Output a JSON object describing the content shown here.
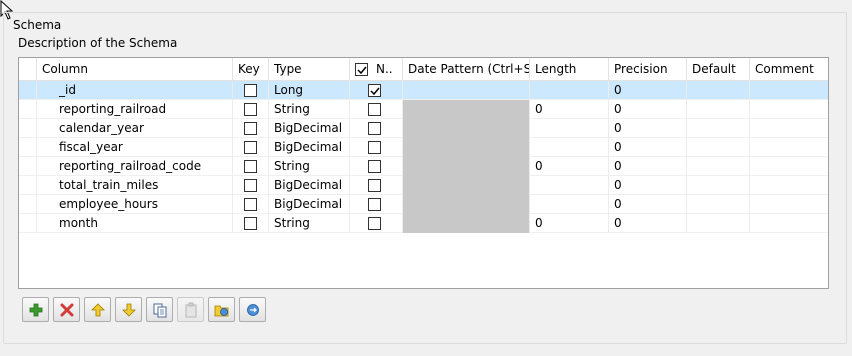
{
  "group": {
    "title": "Schema"
  },
  "description_label": "Description of the Schema",
  "columns": {
    "column": "Column",
    "key": "Key",
    "type": "Type",
    "nullable": "N..",
    "date_pattern": "Date Pattern (Ctrl+S...",
    "length": "Length",
    "precision": "Precision",
    "default": "Default",
    "comment": "Comment"
  },
  "rows": [
    {
      "column": "_id",
      "key": false,
      "type": "Long",
      "nullable": true,
      "length": "",
      "precision": "0",
      "default": "",
      "comment": ""
    },
    {
      "column": "reporting_railroad",
      "key": false,
      "type": "String",
      "nullable": false,
      "length": "0",
      "precision": "0",
      "default": "",
      "comment": ""
    },
    {
      "column": "calendar_year",
      "key": false,
      "type": "BigDecimal",
      "nullable": false,
      "length": "",
      "precision": "0",
      "default": "",
      "comment": ""
    },
    {
      "column": "fiscal_year",
      "key": false,
      "type": "BigDecimal",
      "nullable": false,
      "length": "",
      "precision": "0",
      "default": "",
      "comment": ""
    },
    {
      "column": "reporting_railroad_code",
      "key": false,
      "type": "String",
      "nullable": false,
      "length": "0",
      "precision": "0",
      "default": "",
      "comment": ""
    },
    {
      "column": "total_train_miles",
      "key": false,
      "type": "BigDecimal",
      "nullable": false,
      "length": "",
      "precision": "0",
      "default": "",
      "comment": ""
    },
    {
      "column": "employee_hours",
      "key": false,
      "type": "BigDecimal",
      "nullable": false,
      "length": "",
      "precision": "0",
      "default": "",
      "comment": ""
    },
    {
      "column": "month",
      "key": false,
      "type": "String",
      "nullable": false,
      "length": "0",
      "precision": "0",
      "default": "",
      "comment": ""
    }
  ],
  "toolbar": [
    {
      "name": "add-row-button",
      "icon": "plus-icon",
      "enabled": true
    },
    {
      "name": "remove-row-button",
      "icon": "delete-x-icon",
      "enabled": true
    },
    {
      "name": "move-up-button",
      "icon": "arrow-up-icon",
      "enabled": true
    },
    {
      "name": "move-down-button",
      "icon": "arrow-down-icon",
      "enabled": true
    },
    {
      "name": "copy-button",
      "icon": "copy-icon",
      "enabled": true
    },
    {
      "name": "paste-button",
      "icon": "paste-icon",
      "enabled": false
    },
    {
      "name": "import-schema-button",
      "icon": "import-icon",
      "enabled": true
    },
    {
      "name": "export-schema-button",
      "icon": "export-icon",
      "enabled": true
    }
  ],
  "colors": {
    "selection": "#cce8ff",
    "disabled_cell": "#c8c8c8",
    "add_green": "#3c9a2e",
    "remove_red": "#d33b3b",
    "arrow_yellow": "#e6b800"
  }
}
